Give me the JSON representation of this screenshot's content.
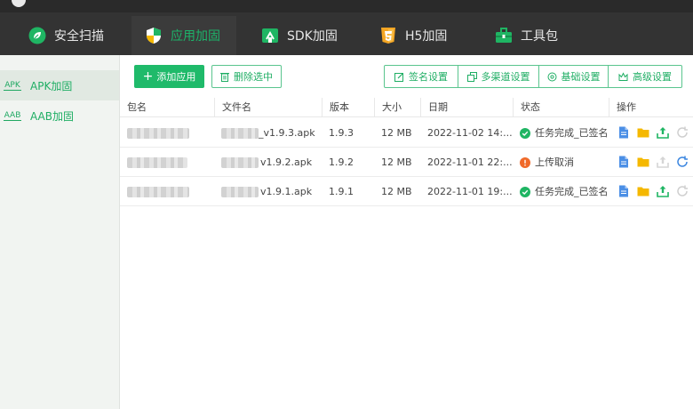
{
  "nav": {
    "tabs": [
      {
        "label": "安全扫描",
        "icon": "leaf-shield-icon"
      },
      {
        "label": "应用加固",
        "icon": "shield-icon"
      },
      {
        "label": "SDK加固",
        "icon": "sdk-box-icon"
      },
      {
        "label": "H5加固",
        "icon": "html5-icon"
      },
      {
        "label": "工具包",
        "icon": "toolbox-icon"
      }
    ],
    "active": "应用加固"
  },
  "sidebar": {
    "items": [
      {
        "tag": "APK",
        "label": "APK加固"
      },
      {
        "tag": "AAB",
        "label": "AAB加固"
      }
    ]
  },
  "toolbar": {
    "add_label": "添加应用",
    "delete_label": "删除选中",
    "sign_label": "签名设置",
    "multichannel_label": "多渠道设置",
    "basic_label": "基础设置",
    "advanced_label": "高级设置"
  },
  "table": {
    "headers": [
      "包名",
      "文件名",
      "版本",
      "大小",
      "日期",
      "状态",
      "操作"
    ],
    "rows": [
      {
        "filename": "_v1.9.3.apk",
        "version": "1.9.3",
        "size": "12 MB",
        "date": "2022-11-02 14:...",
        "status": "任务完成_已签名",
        "state": "ok"
      },
      {
        "filename": "v1.9.2.apk",
        "version": "1.9.2",
        "size": "12 MB",
        "date": "2022-11-01 22:...",
        "status": "上传取消",
        "state": "err"
      },
      {
        "filename": "v1.9.1.apk",
        "version": "1.9.1",
        "size": "12 MB",
        "date": "2022-11-01 19:...",
        "status": "任务完成_已签名",
        "state": "ok"
      }
    ]
  },
  "colors": {
    "accent": "#1fba6a",
    "topbar": "#333333",
    "error": "#f06a2a",
    "file_icon": "#4b8fe6",
    "folder_icon": "#f5b800"
  }
}
